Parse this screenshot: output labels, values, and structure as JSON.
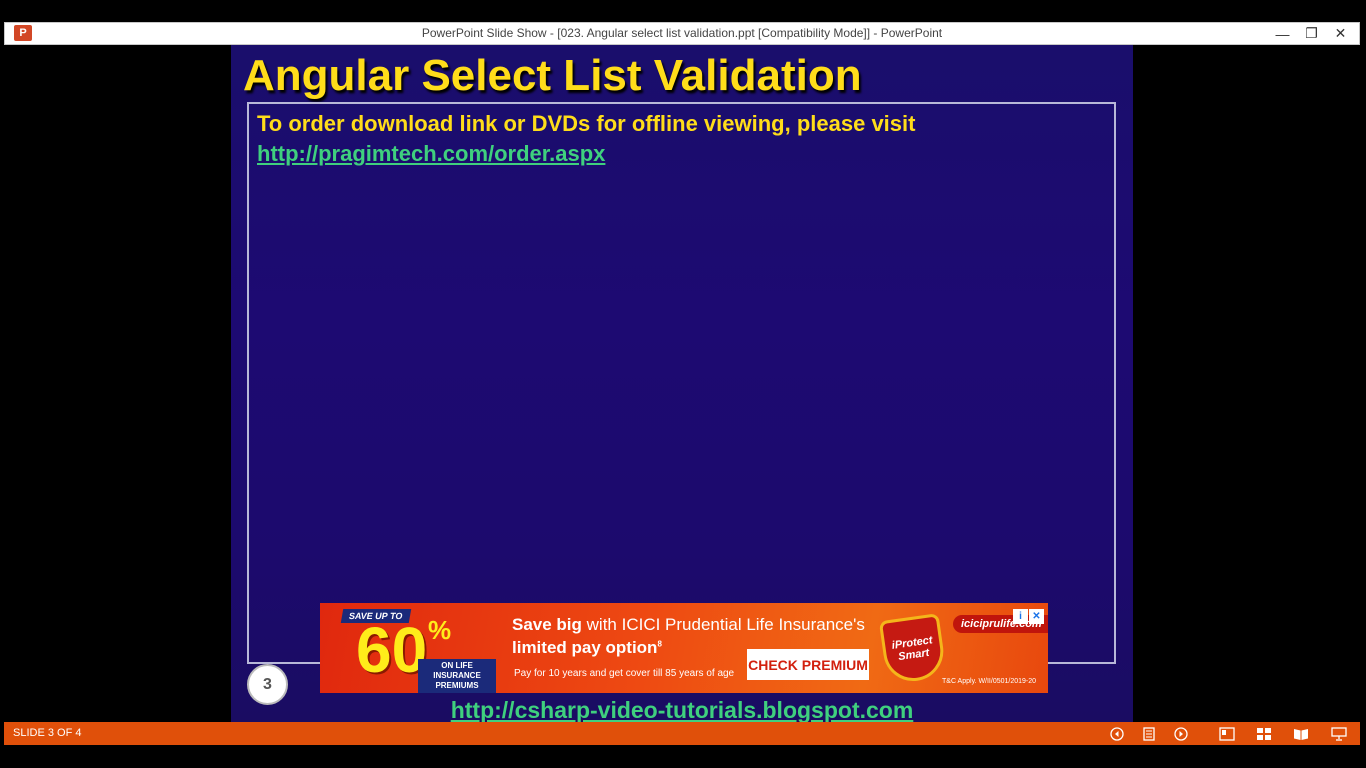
{
  "window": {
    "title": "PowerPoint Slide Show - [023. Angular select list validation.ppt [Compatibility Mode]] - PowerPoint",
    "app_icon_letter": "P",
    "controls": {
      "minimize": "—",
      "restore": "❐",
      "close": "✕"
    }
  },
  "slide": {
    "title": "Angular Select List Validation",
    "order_text": "To order download link or DVDs for offline viewing, please visit",
    "order_link": "http://pragimtech.com/order.aspx",
    "slide_number": "3",
    "footer_link": "http://csharp-video-tutorials.blogspot.com"
  },
  "ad": {
    "save_up_to": "SAVE UP TO",
    "big_number": "60",
    "percent": "%",
    "premiums_label": "ON LIFE INSURANCE PREMIUMS",
    "headline_bold": "Save big",
    "headline_rest": " with ICICI Prudential Life Insurance's",
    "subline": "limited pay option",
    "subline_mark": "8",
    "small_text": "Pay for 10 years and get cover till 85 years of age",
    "cta": "CHECK PREMIUM",
    "shield_top": "iProtect",
    "shield_bottom": "Smart",
    "brand": "iciciprulife.com",
    "disclaimer": "T&C Apply. W/II/0501/2019-20",
    "info_icon": "i",
    "close_icon": "✕"
  },
  "statusbar": {
    "slide_counter": "SLIDE 3 OF 4"
  },
  "colors": {
    "slide_bg": "#1d0a72",
    "title_yellow": "#ffdd1a",
    "link_green": "#3fd07e",
    "statusbar_orange": "#e0500a",
    "ad_red": "#e0280e"
  }
}
